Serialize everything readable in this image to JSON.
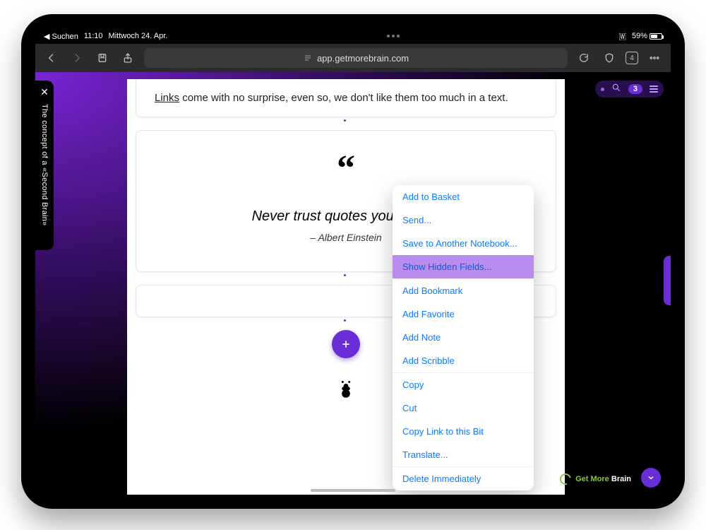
{
  "status": {
    "back_app": "Suchen",
    "time": "11:10",
    "date": "Mittwoch 24. Apr.",
    "battery_pct": "59%"
  },
  "browser": {
    "url": "app.getmorebrain.com",
    "tab_count": "4"
  },
  "app": {
    "vtab_title": "The concept of a «Second Brain»",
    "right_badge": "3",
    "brand_1": "Get More",
    "brand_2": "Brain"
  },
  "cards": {
    "links_word": "Links",
    "links_rest": " come with no surprise, even so, we don't like them too much in a text.",
    "quote_text": "Never trust quotes you find on",
    "quote_author": "– Albert Einstein"
  },
  "menu": {
    "items": [
      "Add to Basket",
      "Send...",
      "Save to Another Notebook...",
      "Show Hidden Fields...",
      "Add Bookmark",
      "Add Favorite",
      "Add Note",
      "Add Scribble",
      "Copy",
      "Cut",
      "Copy Link to this Bit",
      "Translate...",
      "Delete Immediately"
    ],
    "selected_index": 3
  }
}
